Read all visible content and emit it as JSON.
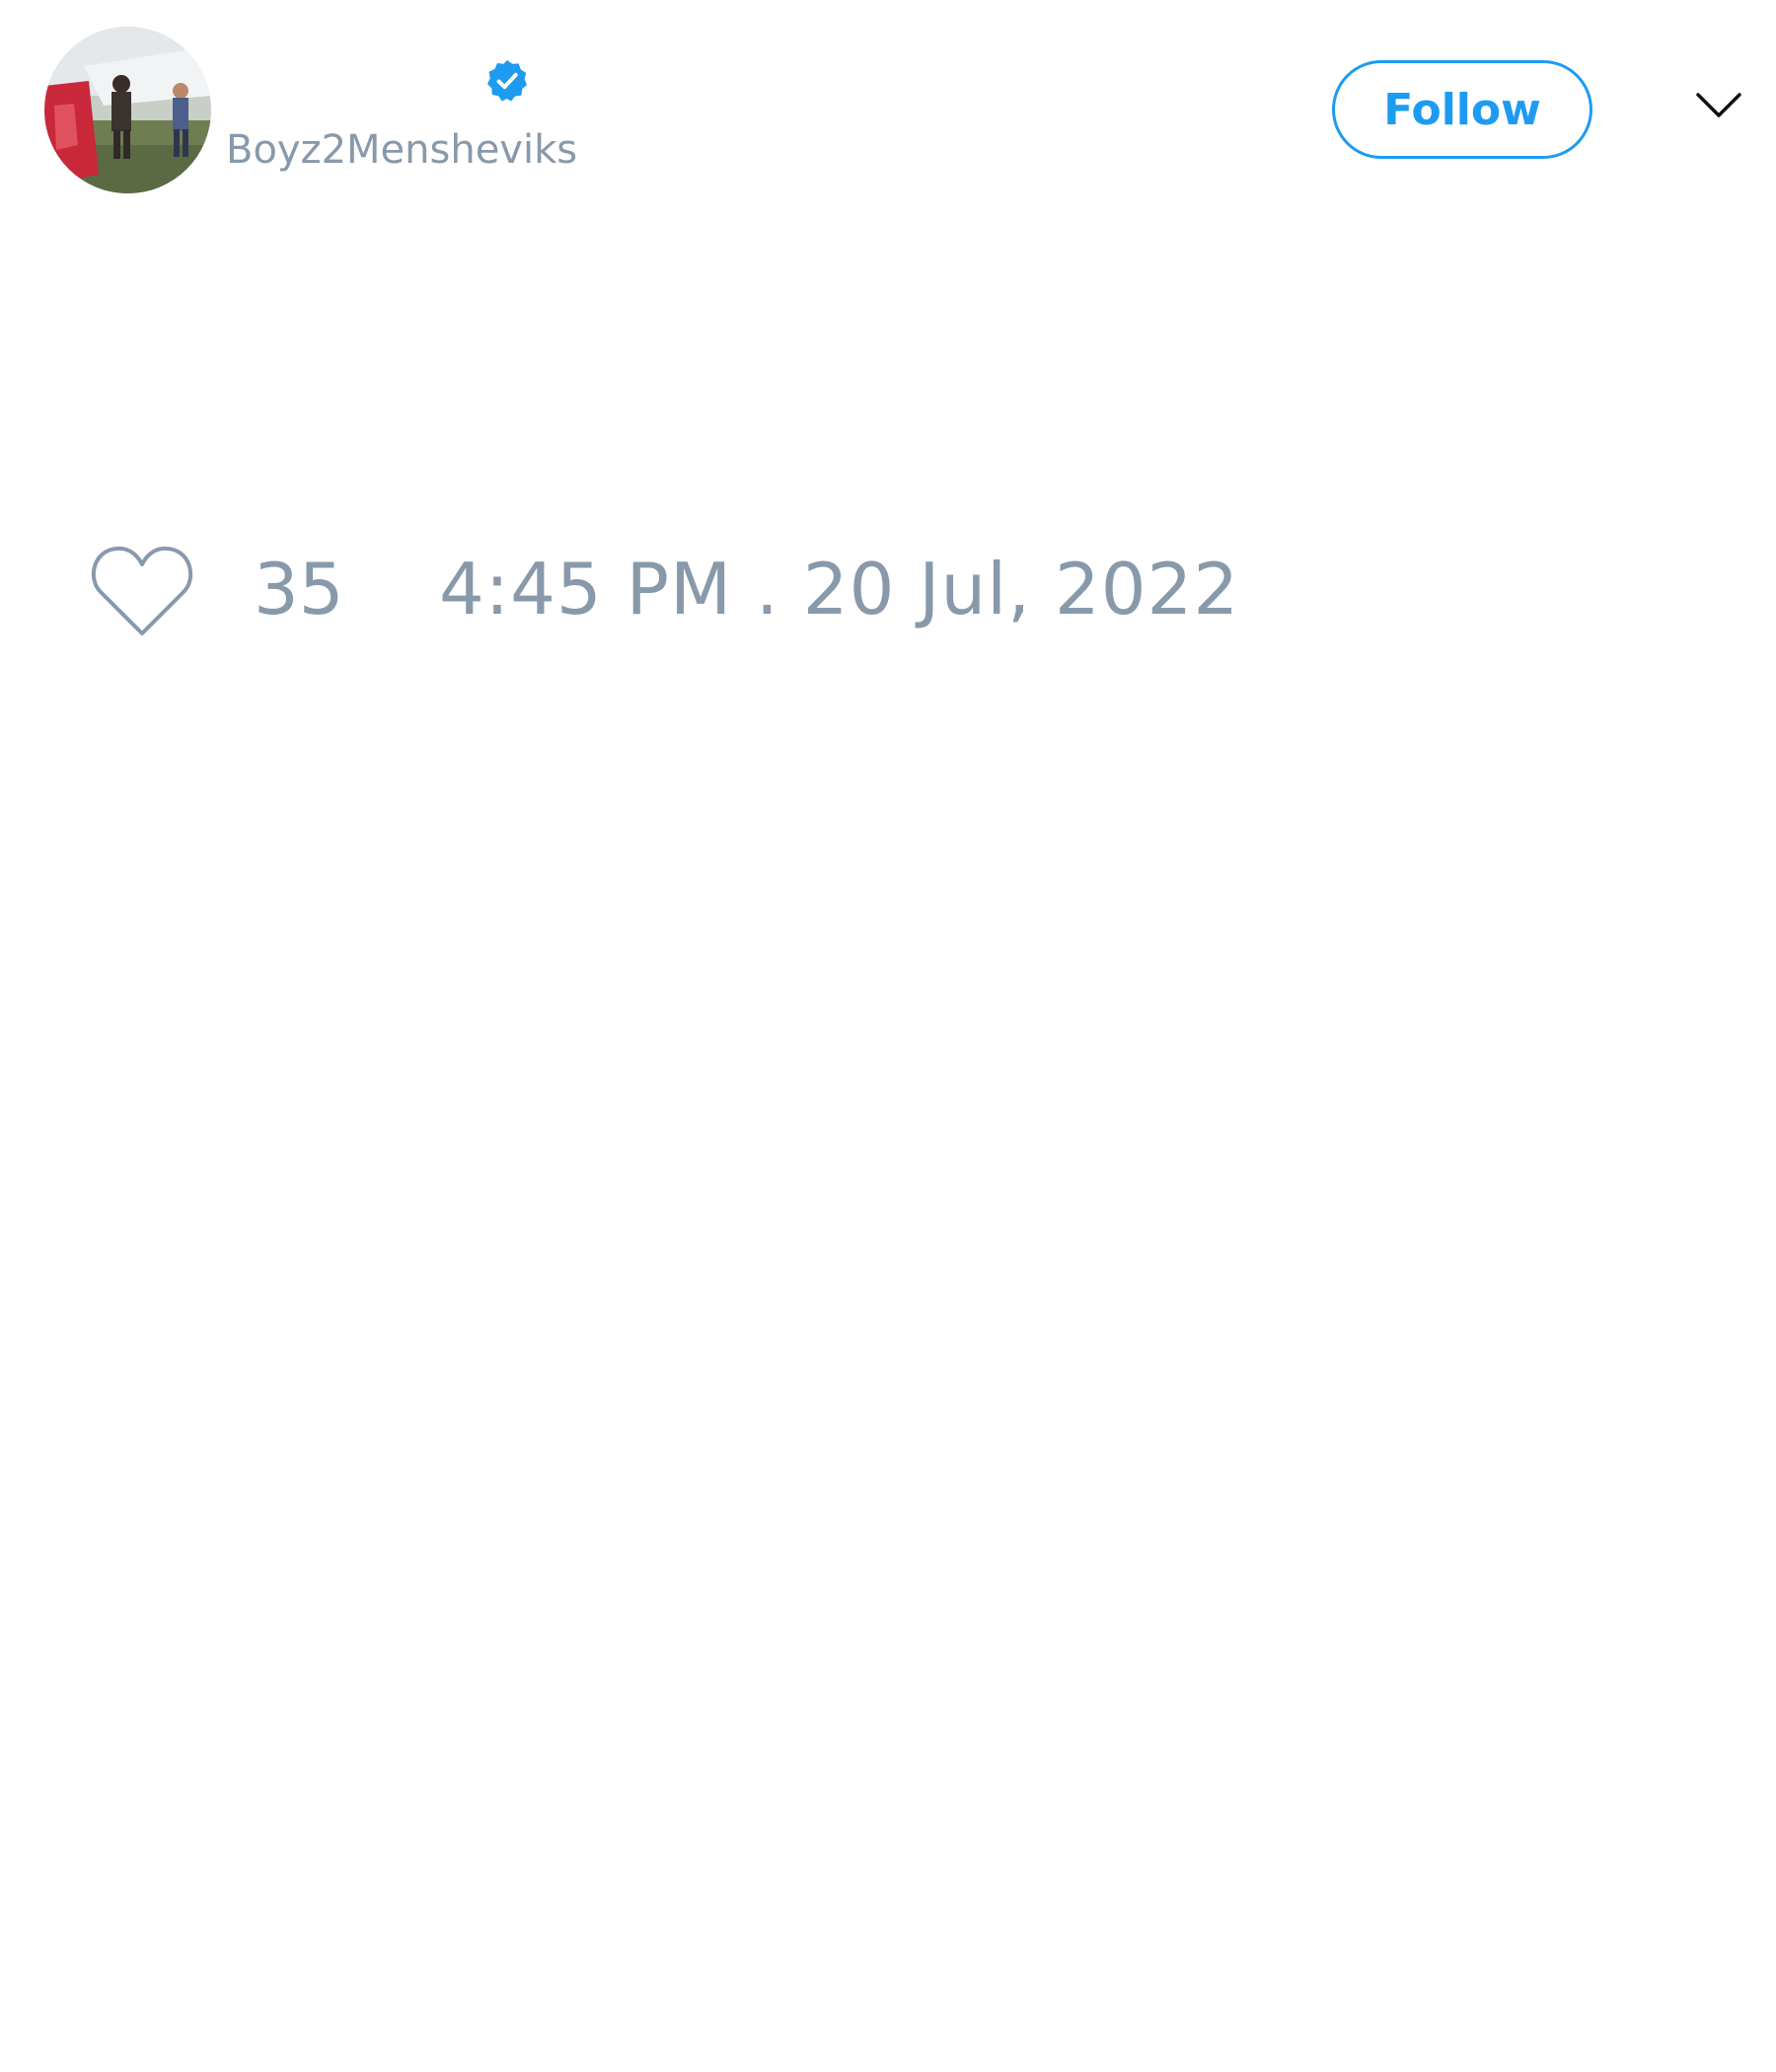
{
  "tweet": {
    "author": {
      "handle": "Boyz2Mensheviks",
      "verified": true,
      "avatar_icon": "avatar-photo-icon"
    },
    "follow_label": "Follow",
    "menu_icon": "chevron-down-icon",
    "likes": "35",
    "like_icon": "heart-outline-icon",
    "timestamp": "4:45 PM . 20 Jul, 2022"
  },
  "colors": {
    "accent": "#1d9bf0",
    "muted_text": "#8899aa",
    "background": "#ffffff"
  }
}
